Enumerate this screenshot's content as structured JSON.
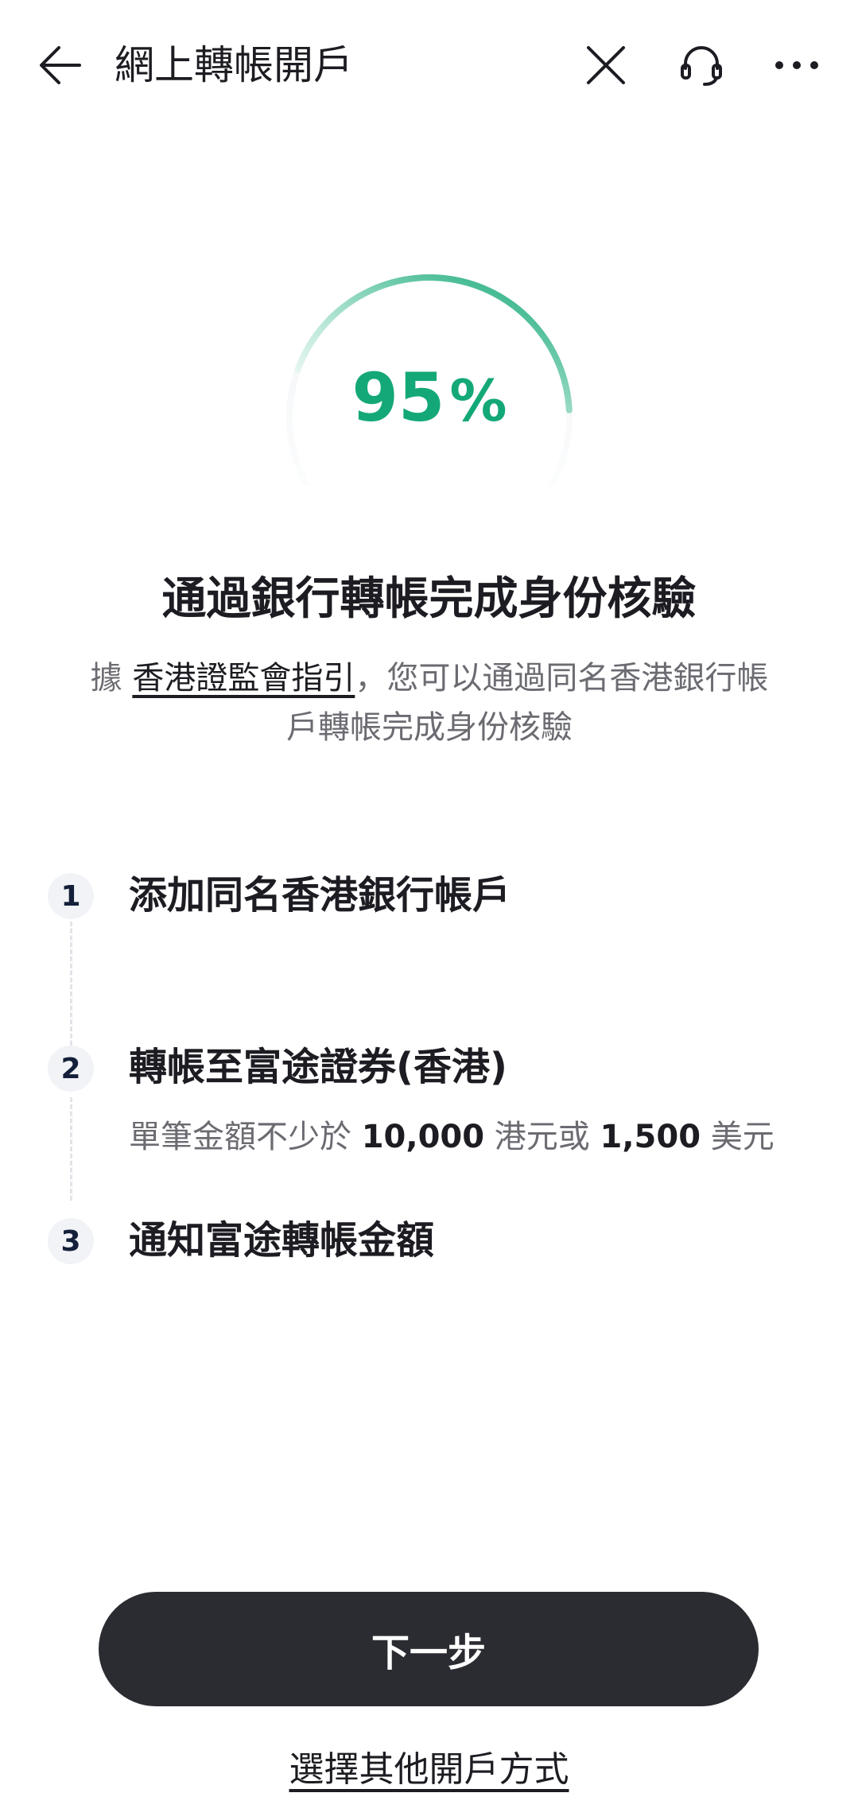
{
  "header": {
    "title": "網上轉帳開戶",
    "back_icon": "arrow-left-icon",
    "close_icon": "close-icon",
    "support_icon": "headset-icon",
    "more_icon": "more-horizontal-icon"
  },
  "progress": {
    "value": 95,
    "percent_sign": "%",
    "color": "#14a878"
  },
  "main": {
    "title": "通過銀行轉帳完成身份核驗",
    "subtitle_prefix": "據 ",
    "subtitle_link": "香港證監會指引",
    "subtitle_rest": "，您可以通過同名香港銀行帳戶轉帳完成身份核驗"
  },
  "steps": [
    {
      "number": "1",
      "title": "添加同名香港銀行帳戶"
    },
    {
      "number": "2",
      "title": "轉帳至富途證券(香港)",
      "desc_part1": "單筆金額不少於 ",
      "desc_amount1": "10,000",
      "desc_part2": " 港元或 ",
      "desc_amount2": "1,500",
      "desc_part3": " 美元"
    },
    {
      "number": "3",
      "title": "通知富途轉帳金額"
    }
  ],
  "actions": {
    "next_label": "下一步",
    "other_label": "選擇其他開戶方式"
  }
}
